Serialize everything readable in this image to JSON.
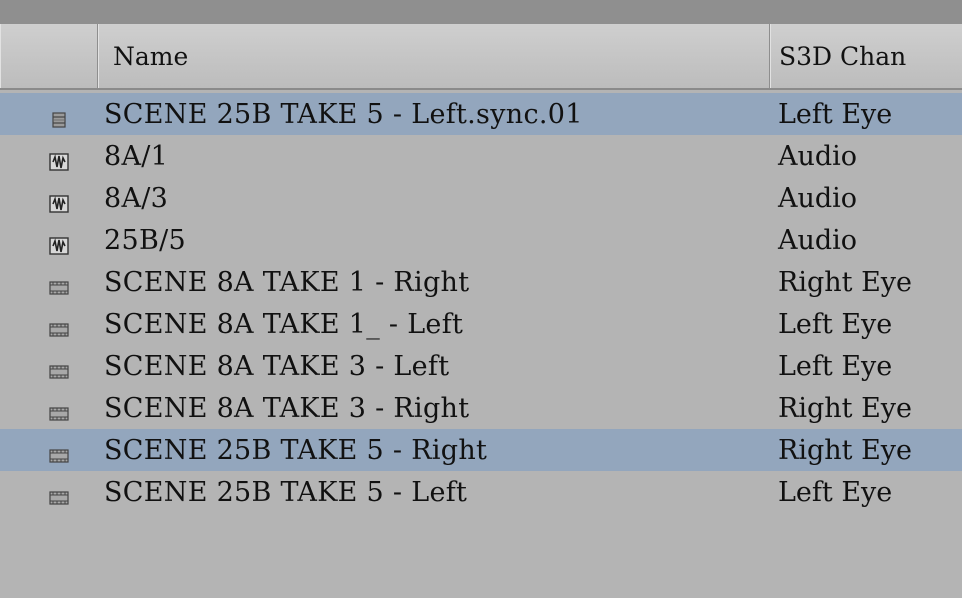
{
  "columns": {
    "icon": "",
    "name": "Name",
    "s3d": "S3D Chan"
  },
  "rows": [
    {
      "name": "SCENE 25B TAKE 5 - Left.sync.01",
      "s3d": "Left Eye",
      "icon": "clip-icon",
      "selected": true
    },
    {
      "name": "8A/1",
      "s3d": "Audio",
      "icon": "audio-clip-icon",
      "selected": false
    },
    {
      "name": "8A/3",
      "s3d": "Audio",
      "icon": "audio-clip-icon",
      "selected": false
    },
    {
      "name": "25B/5",
      "s3d": "Audio",
      "icon": "audio-clip-icon",
      "selected": false
    },
    {
      "name": "SCENE 8A TAKE 1 - Right",
      "s3d": "Right Eye",
      "icon": "video-clip-icon",
      "selected": false
    },
    {
      "name": "SCENE 8A TAKE 1_ - Left",
      "s3d": "Left Eye",
      "icon": "video-clip-icon",
      "selected": false
    },
    {
      "name": "SCENE 8A TAKE 3 - Left",
      "s3d": "Left Eye",
      "icon": "video-clip-icon",
      "selected": false
    },
    {
      "name": "SCENE 8A TAKE 3 - Right",
      "s3d": "Right Eye",
      "icon": "video-clip-icon",
      "selected": false
    },
    {
      "name": "SCENE 25B TAKE 5 - Right",
      "s3d": "Right Eye",
      "icon": "video-clip-icon",
      "selected": true
    },
    {
      "name": "SCENE 25B TAKE 5 - Left",
      "s3d": "Left Eye",
      "icon": "video-clip-icon",
      "selected": false
    }
  ],
  "colors": {
    "selection": "#93a6bd",
    "background": "#b4b4b4"
  }
}
